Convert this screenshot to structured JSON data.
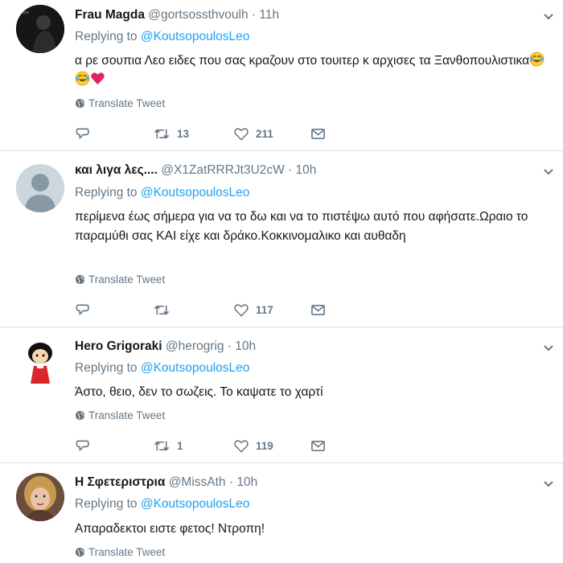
{
  "reply_prefix": "Replying to",
  "translate_label": "Translate Tweet",
  "colors": {
    "link": "#1da1f2",
    "muted": "#657786",
    "text": "#14171a",
    "separator": "#d8dde1",
    "heart": "#e0245e"
  },
  "tweets": [
    {
      "name": "Frau Magda",
      "handle": "@gortsossthvoulh",
      "time": "· 11h",
      "reply_to": "@KoutsopoulosLeo",
      "text": "α ρε σουπια Λεο ειδες που σας κραζουν στο τουιτερ κ αρχισες τα Ξανθοπουλιστικα",
      "emojis": [
        "face-with-tears-of-joy",
        "face-with-tears-of-joy",
        "red-heart"
      ],
      "retweets": "13",
      "likes": "211"
    },
    {
      "name": "και λιγα λες....",
      "handle": "@X1ZatRRRJt3U2cW",
      "time": "· 10h",
      "reply_to": "@KoutsopoulosLeo",
      "text": "περίμενα έως σήμερα για να το δω και να το πιστέψω αυτό που αφήσατε.Ωραιο το παραμύθι σας ΚΑΙ είχε και δράκο.Κοκκινομαλικο και αυθαδη",
      "retweets": "",
      "likes": "117"
    },
    {
      "name": "Hero Grigoraki",
      "handle": "@herogrig",
      "time": "· 10h",
      "reply_to": "@KoutsopoulosLeo",
      "text": "Άστο, θειο, δεν το σωζεις. Το καψατε το χαρτί",
      "retweets": "1",
      "likes": "119"
    },
    {
      "name": "Η Σφετεριστρια",
      "handle": "@MissAth",
      "time": "· 10h",
      "reply_to": "@KoutsopoulosLeo",
      "text": "Απαραδεκτοι ειστε φετος! Ντροπη!"
    }
  ]
}
